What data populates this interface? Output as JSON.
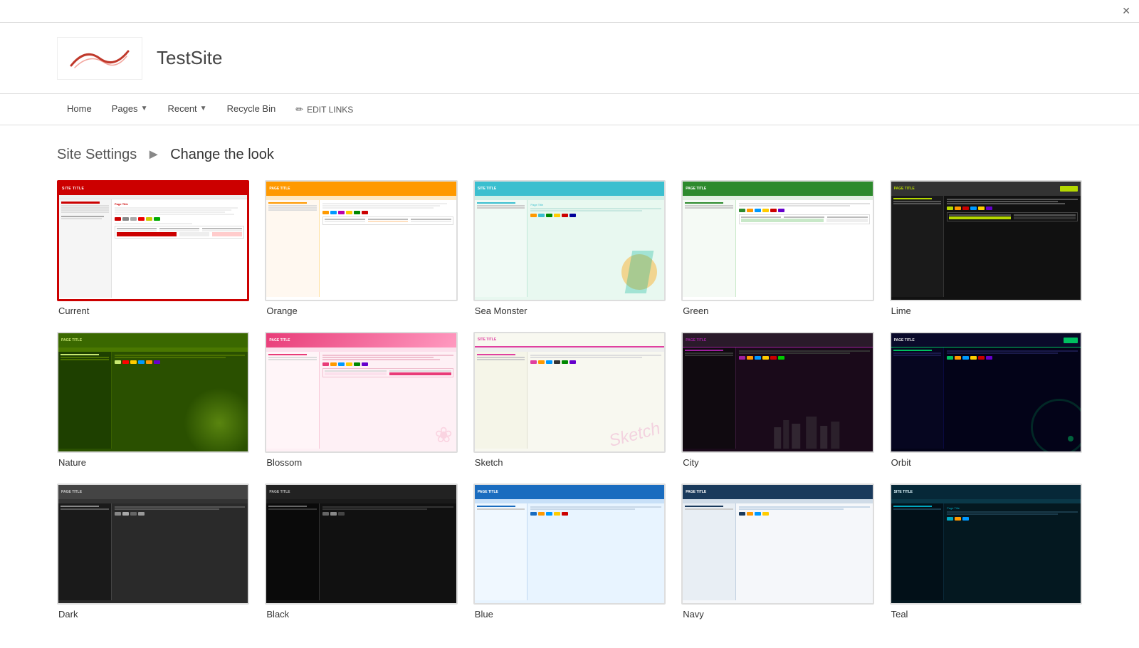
{
  "topbar": {
    "close_icon": "✕"
  },
  "header": {
    "site_title": "TestSite",
    "logo_alt": "TestSite Logo"
  },
  "nav": {
    "items": [
      {
        "label": "Home",
        "has_dropdown": false
      },
      {
        "label": "Pages",
        "has_dropdown": true
      },
      {
        "label": "Recent",
        "has_dropdown": true
      },
      {
        "label": "Recycle Bin",
        "has_dropdown": false
      }
    ],
    "edit_links_label": "EDIT LINKS"
  },
  "breadcrumb": {
    "parent": "Site Settings",
    "separator": "▶",
    "current": "Change the look"
  },
  "themes": {
    "row1": [
      {
        "id": "current",
        "label": "Current",
        "is_current": true
      },
      {
        "id": "orange",
        "label": "Orange",
        "is_current": false
      },
      {
        "id": "seamonster",
        "label": "Sea Monster",
        "is_current": false
      },
      {
        "id": "green",
        "label": "Green",
        "is_current": false
      },
      {
        "id": "lime",
        "label": "Lime",
        "is_current": false
      }
    ],
    "row2": [
      {
        "id": "nature",
        "label": "Nature",
        "is_current": false
      },
      {
        "id": "blossom",
        "label": "Blossom",
        "is_current": false
      },
      {
        "id": "sketch",
        "label": "Sketch",
        "is_current": false
      },
      {
        "id": "city",
        "label": "City",
        "is_current": false
      },
      {
        "id": "orbit",
        "label": "Orbit",
        "is_current": false
      }
    ],
    "row3": [
      {
        "id": "dark",
        "label": "Dark",
        "is_current": false
      },
      {
        "id": "black",
        "label": "Black",
        "is_current": false
      },
      {
        "id": "blue",
        "label": "Blue",
        "is_current": false
      },
      {
        "id": "navy",
        "label": "Navy",
        "is_current": false
      },
      {
        "id": "teal",
        "label": "Teal",
        "is_current": false
      }
    ]
  }
}
